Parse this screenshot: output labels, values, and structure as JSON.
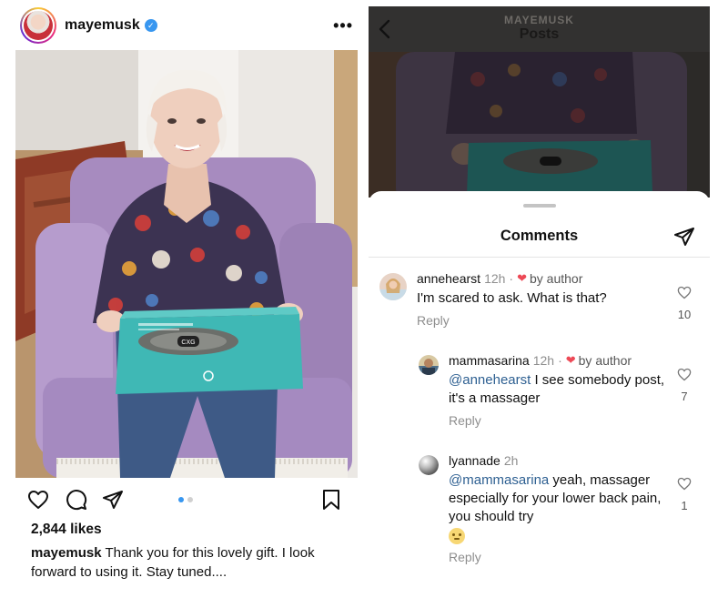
{
  "post": {
    "username": "mayemusk",
    "verified": true,
    "more_label": "•••",
    "likes": "2,844 likes",
    "caption_user": "mayemusk",
    "caption_text": "Thank you for this lovely gift. I look forward to using it. Stay tuned....",
    "carousel": {
      "count": 2,
      "active": 1
    },
    "product_logo": "CXG"
  },
  "comments_view": {
    "nav_account": "MAYEMUSK",
    "nav_title": "Posts",
    "sheet_title": "Comments",
    "comments": [
      {
        "username": "annehearst",
        "time": "12h",
        "badge": "by author",
        "mention": "",
        "text": "I'm scared to ask. What is that?",
        "reply": "Reply",
        "likes": "10"
      },
      {
        "username": "mammasarina",
        "time": "12h",
        "badge": "by author",
        "mention": "@annehearst",
        "text": " I see somebody post, it's a massager",
        "reply": "Reply",
        "likes": "7"
      },
      {
        "username": "lyannade",
        "time": "2h",
        "badge": "",
        "mention": "@mammasarina",
        "text": " yeah, massager especially for your lower back pain, you should try",
        "reply": "Reply",
        "likes": "1"
      }
    ]
  },
  "colors": {
    "verified": "#3897f0",
    "like_red": "#ed4956",
    "mention": "#2d5f91",
    "muted": "#8e8e8e",
    "box_teal": "#3fb8b5"
  }
}
